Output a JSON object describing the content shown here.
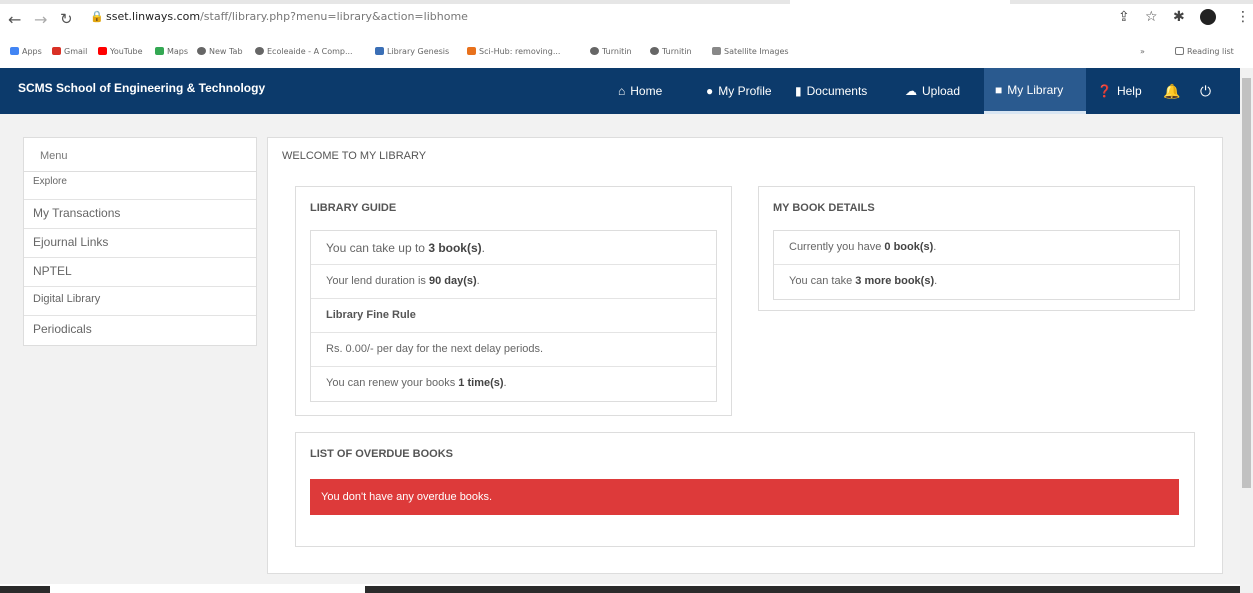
{
  "browser": {
    "url_host": "sset.linways.com",
    "url_path": "/staff/library.php?menu=library&action=libhome",
    "bookmarks": [
      "Apps",
      "Gmail",
      "YouTube",
      "Maps",
      "New Tab",
      "Ecoleaide - A Comp...",
      "Library Genesis",
      "Sci-Hub: removing...",
      "Turnitin",
      "Turnitin",
      "Satellite Images"
    ],
    "reading_list": "Reading list"
  },
  "header": {
    "brand": "SCMS School of Engineering & Technology",
    "nav": {
      "home": "Home",
      "profile": "My Profile",
      "documents": "Documents",
      "upload": "Upload",
      "library": "My Library",
      "help": "Help"
    }
  },
  "sidebar": {
    "heading": "Menu",
    "items": [
      "Explore",
      "My Transactions",
      "Ejournal Links",
      "NPTEL",
      "Digital Library",
      "Periodicals"
    ]
  },
  "main": {
    "title": "WELCOME TO MY LIBRARY",
    "guide": {
      "title": "LIBRARY GUIDE",
      "take_pre": "You can take up to ",
      "take_val": "3 book(s)",
      "take_post": ".",
      "lend_pre": "Your lend duration is ",
      "lend_val": "90 day(s)",
      "lend_post": ".",
      "fine_heading": "Library Fine Rule",
      "fine_text": "Rs. 0.00/- per day for the next delay periods.",
      "renew_pre": "You can renew your books ",
      "renew_val": "1 time(s)",
      "renew_post": "."
    },
    "details": {
      "title": "MY BOOK DETAILS",
      "current_pre": "Currently you have ",
      "current_val": "0 book(s)",
      "current_post": ".",
      "more_pre": "You can take ",
      "more_val": "3 more book(s)",
      "more_post": "."
    },
    "overdue": {
      "title": "LIST OF OVERDUE BOOKS",
      "message": "You don't have any overdue books."
    }
  },
  "colors": {
    "header_bg": "#0c3a6b",
    "alert_bg": "#dd3a3a"
  }
}
